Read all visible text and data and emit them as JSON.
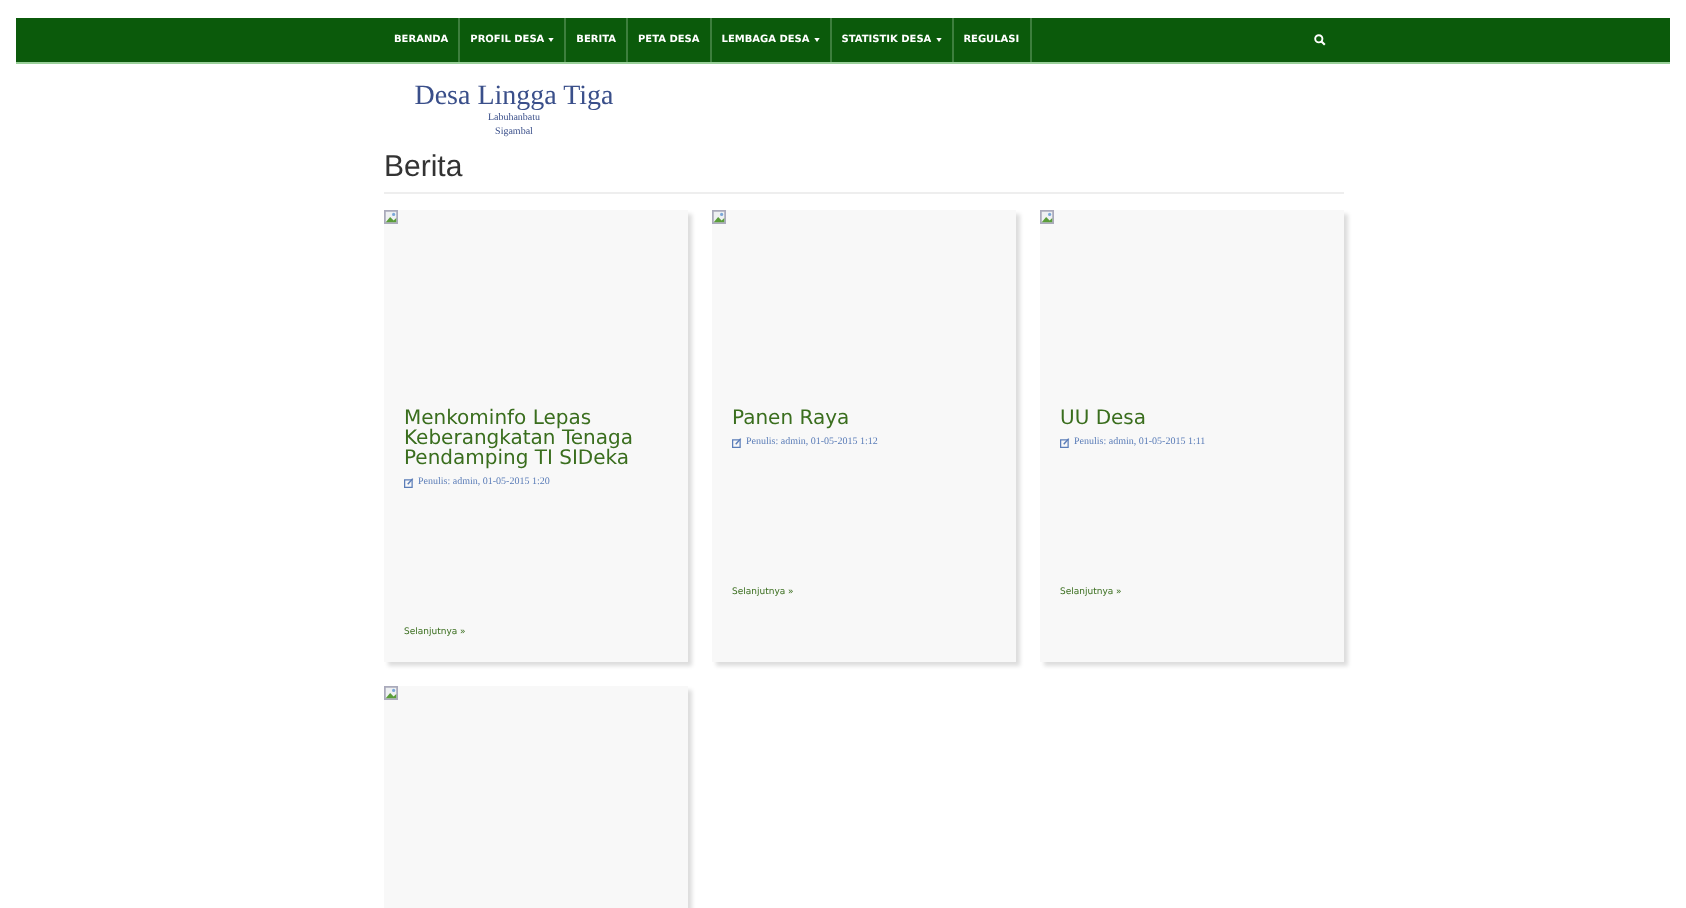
{
  "nav": {
    "items": [
      {
        "label": "BERANDA",
        "dropdown": false
      },
      {
        "label": "PROFIL DESA",
        "dropdown": true
      },
      {
        "label": "BERITA",
        "dropdown": false
      },
      {
        "label": "PETA DESA",
        "dropdown": false
      },
      {
        "label": "LEMBAGA DESA",
        "dropdown": true
      },
      {
        "label": "STATISTIK DESA",
        "dropdown": true
      },
      {
        "label": "REGULASI",
        "dropdown": false
      }
    ]
  },
  "logo": {
    "title": "Desa Lingga Tiga",
    "line_1": "Labuhanbatu",
    "line_2": "Sigambal"
  },
  "section_title": "Berita",
  "articles": [
    {
      "kind": "article",
      "title": "Menkominfo Lepas Keberangkatan Tenaga Pendamping TI SIDeka",
      "meta": "Penulis: admin, 01-05-2015 1:20",
      "more": "Selanjutnya »"
    },
    {
      "kind": "article",
      "title": "Panen Raya",
      "meta": "Penulis: admin, 01-05-2015 1:12",
      "more": "Selanjutnya »"
    },
    {
      "kind": "article",
      "title": "UU Desa",
      "meta": "Penulis: admin, 01-05-2015 1:11",
      "more": "Selanjutnya »"
    },
    {
      "kind": "article"
    }
  ]
}
